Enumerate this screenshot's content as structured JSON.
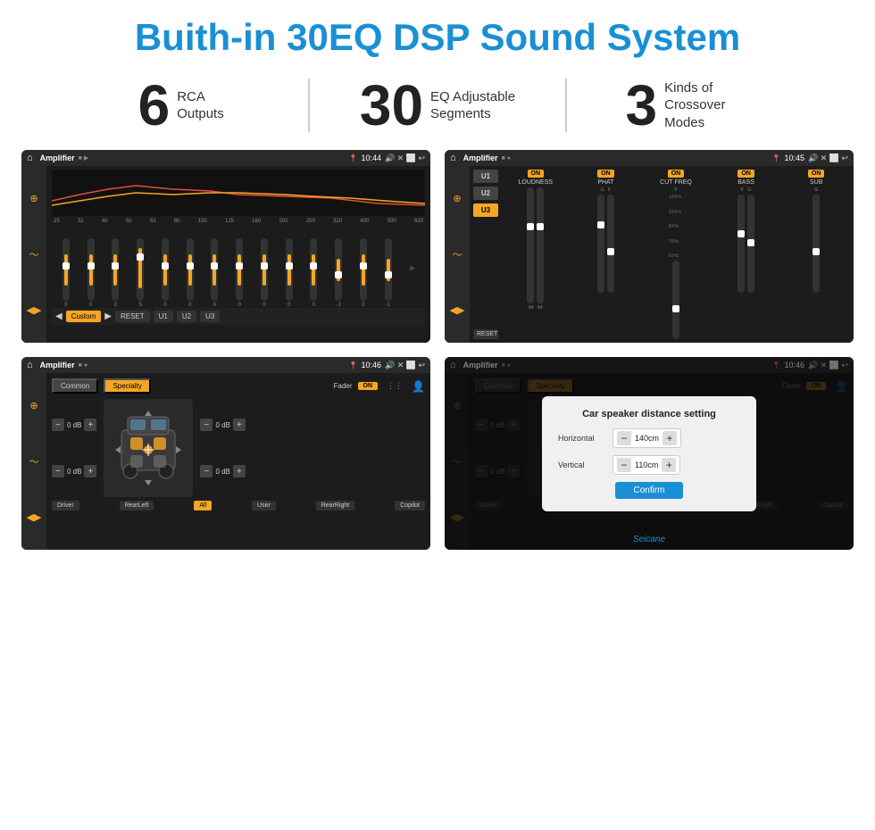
{
  "header": {
    "title": "Buith-in 30EQ DSP Sound System"
  },
  "stats": [
    {
      "number": "6",
      "label": "RCA\nOutputs"
    },
    {
      "number": "30",
      "label": "EQ Adjustable\nSegments"
    },
    {
      "number": "3",
      "label": "Kinds of\nCrossover Modes"
    }
  ],
  "screens": {
    "eq": {
      "title": "Amplifier",
      "time": "10:44",
      "frequencies": [
        "25",
        "32",
        "40",
        "50",
        "63",
        "80",
        "100",
        "125",
        "160",
        "200",
        "250",
        "320",
        "400",
        "500",
        "630"
      ],
      "values": [
        "0",
        "0",
        "0",
        "5",
        "0",
        "0",
        "0",
        "0",
        "0",
        "0",
        "0",
        "-1",
        "0",
        "-1"
      ],
      "buttons": [
        "Custom",
        "RESET",
        "U1",
        "U2",
        "U3"
      ]
    },
    "crossover": {
      "title": "Amplifier",
      "time": "10:45",
      "presets": [
        "U1",
        "U2",
        "U3"
      ],
      "channels": [
        "LOUDNESS",
        "PHAT",
        "CUT FREQ",
        "BASS",
        "SUB"
      ],
      "reset_label": "RESET"
    },
    "fader": {
      "title": "Amplifier",
      "time": "10:46",
      "tabs": [
        "Common",
        "Specialty"
      ],
      "fader_label": "Fader",
      "on_label": "ON",
      "buttons": [
        "Driver",
        "RearLeft",
        "All",
        "User",
        "RearRight",
        "Copilot"
      ]
    },
    "dialog": {
      "title": "Amplifier",
      "time": "10:46",
      "dialog_title": "Car speaker distance setting",
      "horizontal_label": "Horizontal",
      "horizontal_value": "140cm",
      "vertical_label": "Vertical",
      "vertical_value": "110cm",
      "confirm_label": "Confirm",
      "buttons": [
        "Driver",
        "RearLeft",
        "Copilot",
        "RearRight"
      ],
      "db_label": "0 dB"
    }
  },
  "watermark": "Seicane"
}
